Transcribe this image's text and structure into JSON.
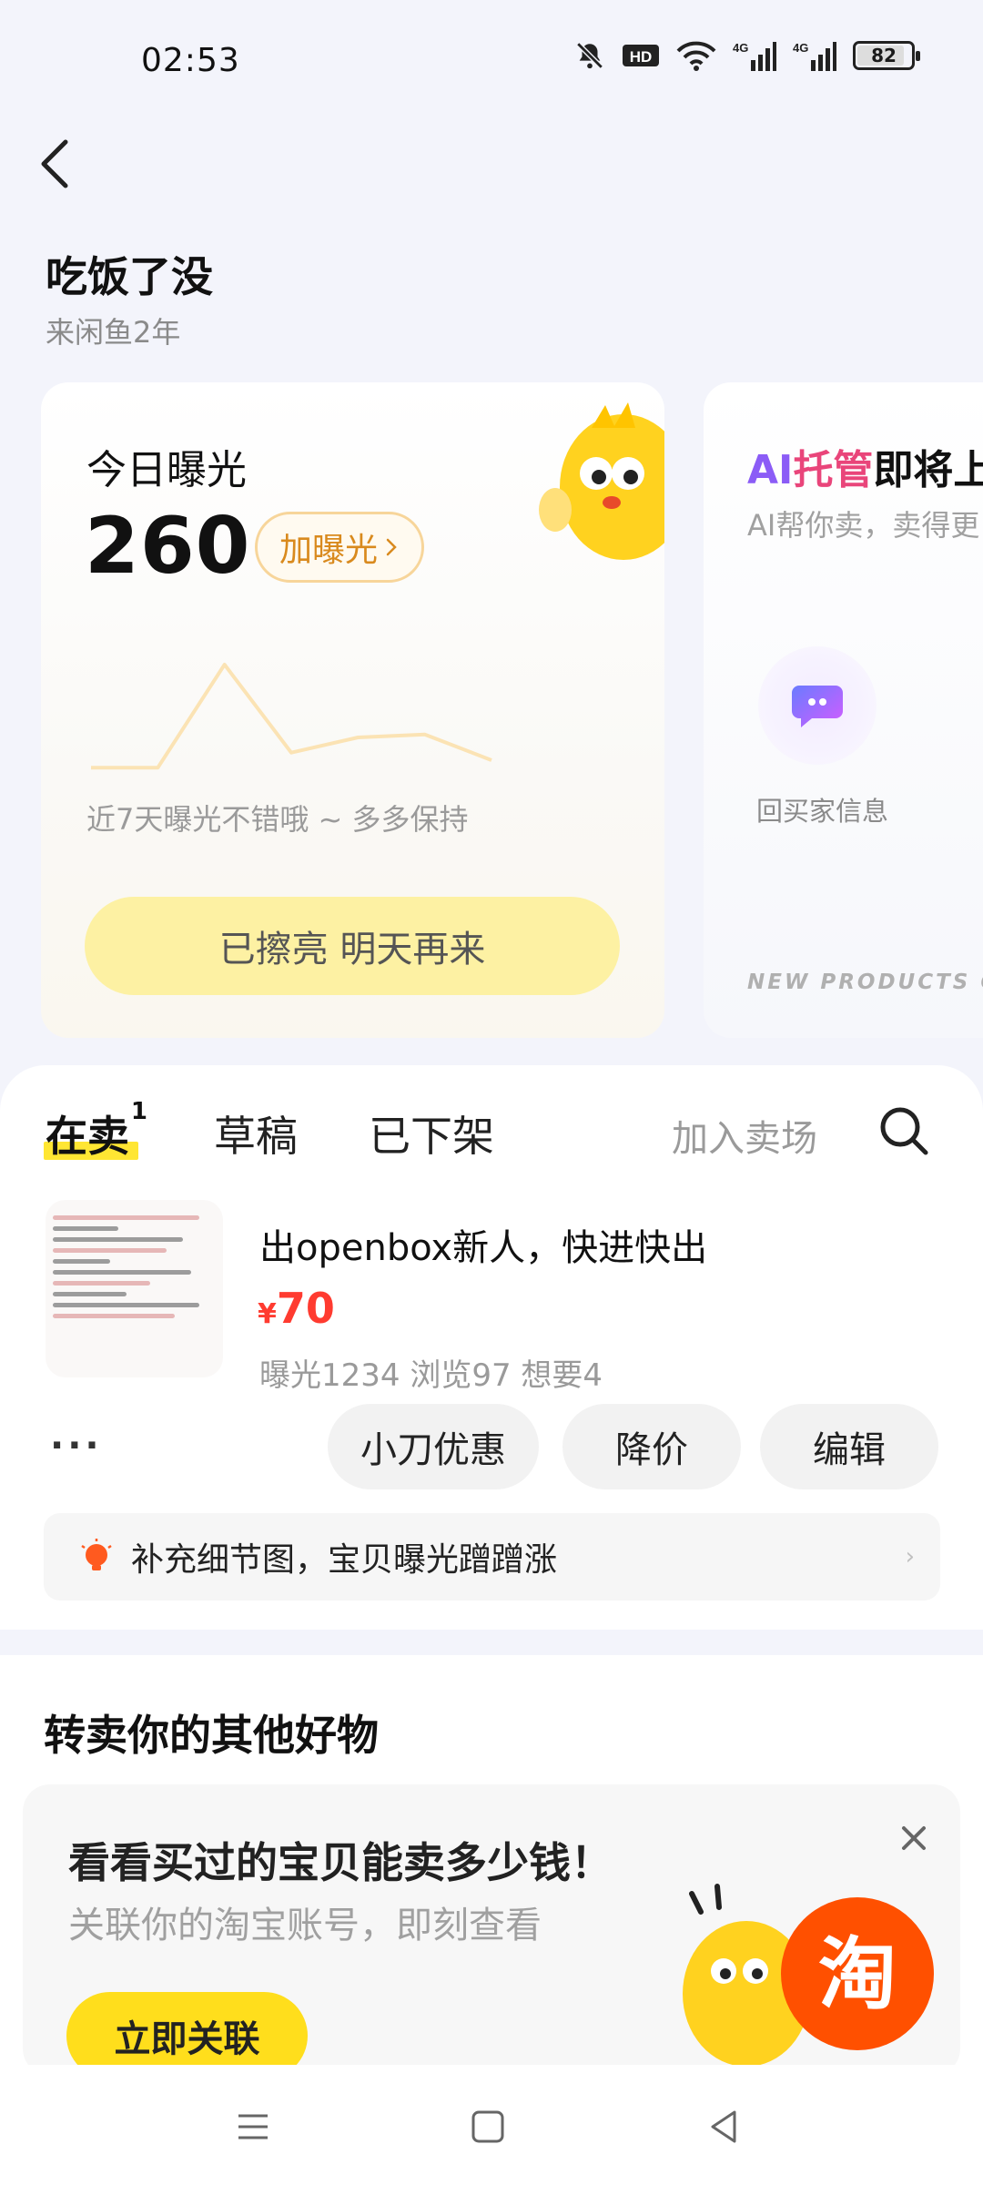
{
  "status_bar": {
    "time": "02:53",
    "icons": [
      "mute-icon",
      "hd-icon",
      "wifi-icon",
      "signal-4g-icon",
      "signal-4g-icon",
      "battery-icon"
    ],
    "hd_label": "HD",
    "net_label": "4G",
    "battery_level": "82"
  },
  "header": {
    "shop_name": "吃饭了没",
    "shop_age": "来闲鱼2年"
  },
  "exposure_card": {
    "title": "今日曝光",
    "count": "260",
    "boost_label": "加曝光",
    "trend_caption": "近7天曝光不错哦 ~ 多多保持",
    "done_label": "已擦亮 明天再来",
    "trend_values": [
      10,
      10,
      78,
      20,
      30,
      32,
      15
    ]
  },
  "ai_card": {
    "title_part1": "AI",
    "title_part2": "托管",
    "title_part3": "即将上",
    "subtitle": "AI帮你卖，卖得更",
    "reply_label": "回买家信息",
    "footer": "NEW PRODUCTS CO"
  },
  "tabs": {
    "on_sale": "在卖",
    "on_sale_count": "1",
    "drafts": "草稿",
    "delisted": "已下架",
    "join_market": "加入卖场"
  },
  "item": {
    "title": "出openbox新人，快进快出",
    "currency": "¥",
    "price": "70",
    "stats": "曝光1234   浏览97   想要4",
    "more_label": "···",
    "action_discount": "小刀优惠",
    "action_reduce": "降价",
    "action_edit": "编辑"
  },
  "tip": {
    "text": "补充细节图，宝贝曝光蹭蹭涨",
    "arrow": "›"
  },
  "resell": {
    "title": "转卖你的其他好物",
    "promo_title": "看看买过的宝贝能卖多少钱！",
    "promo_subtitle": "关联你的淘宝账号，即刻查看",
    "promo_button": "立即关联",
    "taobao_badge": "淘"
  },
  "colors": {
    "accent_yellow": "#ffde1c",
    "price_red": "#ff3b30",
    "taobao_orange": "#ff5000",
    "boost_orange": "#d98a1e"
  }
}
